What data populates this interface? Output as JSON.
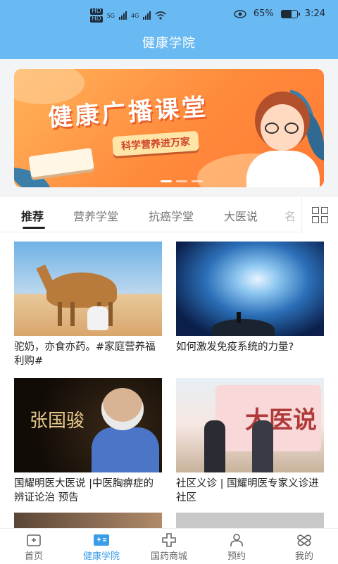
{
  "status_bar": {
    "hd1": "HD",
    "hd2": "HD",
    "net1": "5G",
    "net2": "4G",
    "battery": "65%",
    "battery_level": 0.65,
    "time": "3:24"
  },
  "header": {
    "title": "健康学院"
  },
  "banner": {
    "title": "健康广播课堂",
    "subtitle": "科学营养进万家",
    "slide_count": 3,
    "active_slide": 0
  },
  "tabs": {
    "items": [
      "推荐",
      "营养学堂",
      "抗癌学堂",
      "大医说",
      "名"
    ],
    "active": 0
  },
  "articles": [
    {
      "title": "驼奶，亦食亦药。#家庭营养福利购#",
      "thumb": "camel-desert-image"
    },
    {
      "title": "如何激发免疫系统的力量?",
      "thumb": "galaxy-image"
    },
    {
      "title": "国耀明医大医说 |中医胸痹症的辨证论治 预告",
      "thumb": "doctor-portrait-image",
      "overlay_text": "张国骏"
    },
    {
      "title": "社区义诊 | 国耀明医专家义诊进社区",
      "thumb": "community-event-image",
      "overlay_text": "大医说"
    }
  ],
  "bottom_nav": {
    "items": [
      {
        "label": "首页",
        "icon": "home-icon"
      },
      {
        "label": "健康学院",
        "icon": "academy-icon"
      },
      {
        "label": "国药商城",
        "icon": "mall-icon"
      },
      {
        "label": "预约",
        "icon": "appointment-icon"
      },
      {
        "label": "我的",
        "icon": "profile-icon"
      }
    ],
    "active": 1
  },
  "colors": {
    "primary": "#69b9f2",
    "accent": "#3a9de8",
    "banner_orange": "#ff8a3c"
  }
}
